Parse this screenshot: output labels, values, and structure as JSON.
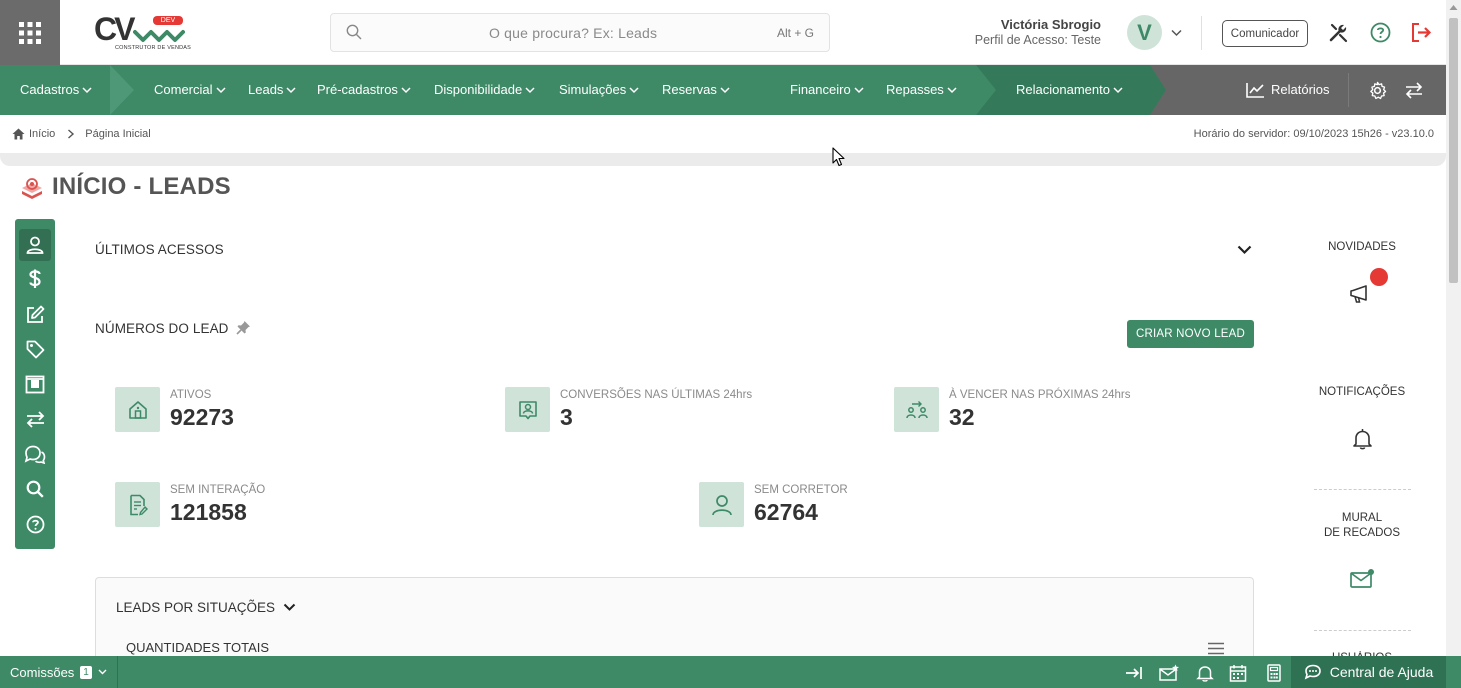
{
  "header": {
    "logo_text": "CV",
    "logo_badge": "DEV",
    "logo_subtitle": "CONSTRUTOR DE VENDAS",
    "search_placeholder": "O que procura? Ex: Leads",
    "search_shortcut": "Alt + G",
    "user_name": "Victória Sbrogio",
    "user_profile": "Perfil de Acesso: Teste",
    "avatar_letter": "V",
    "communicator_label": "Comunicador"
  },
  "nav": {
    "items": [
      {
        "label": "Cadastros"
      },
      {
        "label": "Comercial"
      },
      {
        "label": "Leads"
      },
      {
        "label": "Pré-cadastros"
      },
      {
        "label": "Disponibilidade"
      },
      {
        "label": "Simulações"
      },
      {
        "label": "Reservas"
      },
      {
        "label": "Financeiro"
      },
      {
        "label": "Repasses"
      },
      {
        "label": "Relacionamento"
      }
    ],
    "reports_label": "Relatórios"
  },
  "breadcrumb": {
    "home": "Início",
    "current": "Página Inicial",
    "server_time": "Horário do servidor: 09/10/2023 15h26 - v23.10.0"
  },
  "page": {
    "title": "INÍCIO - LEADS"
  },
  "main": {
    "recent_access_title": "ÚLTIMOS ACESSOS",
    "numbers_title": "NÚMEROS DO LEAD",
    "create_button": "CRIAR NOVO LEAD",
    "stats": [
      {
        "label": "ATIVOS",
        "value": "92273",
        "icon": "house-icon"
      },
      {
        "label": "CONVERSÕES NAS ÚLTIMAS 24hrs",
        "value": "3",
        "icon": "user-badge-icon"
      },
      {
        "label": "À VENCER NAS PRÓXIMAS 24hrs",
        "value": "32",
        "icon": "people-exchange-icon"
      },
      {
        "label": "SEM INTERAÇÃO",
        "value": "121858",
        "icon": "document-edit-icon"
      },
      {
        "label": "SEM CORRETOR",
        "value": "62764",
        "icon": "person-icon"
      }
    ],
    "situations_title": "LEADS POR SITUAÇÕES",
    "totals_title": "QUANTIDADES TOTAIS"
  },
  "right_panel": {
    "news": "NOVIDADES",
    "notifications": "NOTIFICAÇÕES",
    "mural_line1": "MURAL",
    "mural_line2": "DE RECADOS",
    "partial": "USUÁRIOS"
  },
  "bottom": {
    "commissions_label": "Comissões",
    "commissions_count": "1",
    "help_label": "Central de Ajuda"
  },
  "colors": {
    "primary": "#3e8a67",
    "primary_dark": "#2f7153",
    "gray_bar": "#666666",
    "icon_bg": "#cfe3d9",
    "alert_red": "#e53935"
  }
}
